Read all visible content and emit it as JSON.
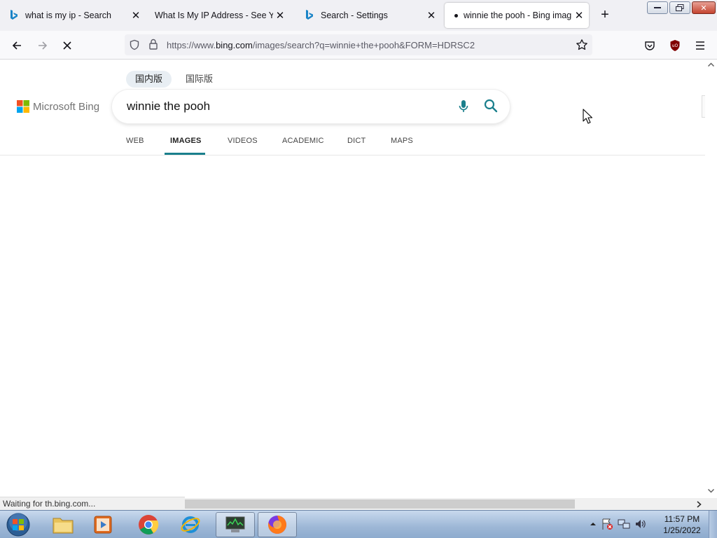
{
  "tabs": [
    {
      "title": "what is my ip - Search",
      "favicon": "bing-icon"
    },
    {
      "title": "What Is My IP Address - See Your",
      "favicon": "none"
    },
    {
      "title": "Search - Settings",
      "favicon": "bing-icon"
    },
    {
      "title": "winnie the pooh - Bing imag",
      "favicon": "loading-dot",
      "active": true
    }
  ],
  "address_bar": {
    "url_prefix": "https://www.",
    "url_domain": "bing.com",
    "url_path": "/images/search?q=winnie+the+pooh&FORM=HDRSC2"
  },
  "bing": {
    "logo_text": "Microsoft Bing",
    "markets": [
      "国内版",
      "国际版"
    ],
    "query": "winnie the pooh",
    "scopes": [
      "WEB",
      "IMAGES",
      "VIDEOS",
      "ACADEMIC",
      "DICT",
      "MAPS"
    ],
    "active_scope": "IMAGES",
    "accent_color": "#1a7f8c"
  },
  "status_text": "Waiting for th.bing.com...",
  "clock": {
    "time": "11:57 PM",
    "date": "1/25/2022"
  }
}
